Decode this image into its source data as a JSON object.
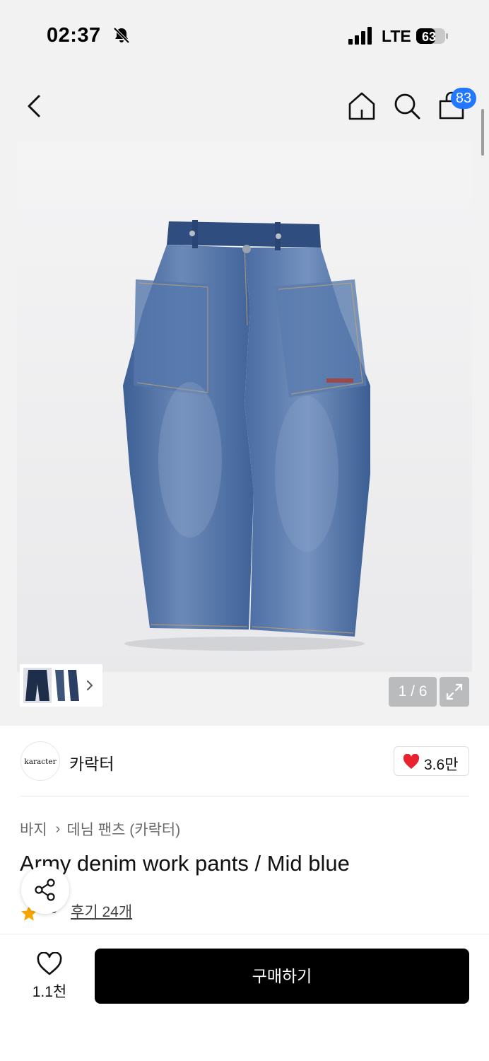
{
  "status_bar": {
    "time": "02:37",
    "network": "LTE",
    "battery": "63"
  },
  "header": {
    "cart_count": "83"
  },
  "gallery": {
    "counter": "1 / 6"
  },
  "brand": {
    "logo_text": "karacter",
    "name": "카락터",
    "likes": "3.6만"
  },
  "breadcrumb": {
    "category": "바지",
    "subcategory": "데님 팬츠 (카락터)"
  },
  "product": {
    "title": "Army denim work pants / Mid blue",
    "rating": ".9",
    "reviews_label": "후기 24개"
  },
  "bottom_bar": {
    "wish_count": "1.1천",
    "buy_label": "구매하기"
  },
  "colors": {
    "badge": "#2478ff",
    "heart": "#e8232e",
    "star": "#f7a600",
    "buy_button": "#000000"
  }
}
